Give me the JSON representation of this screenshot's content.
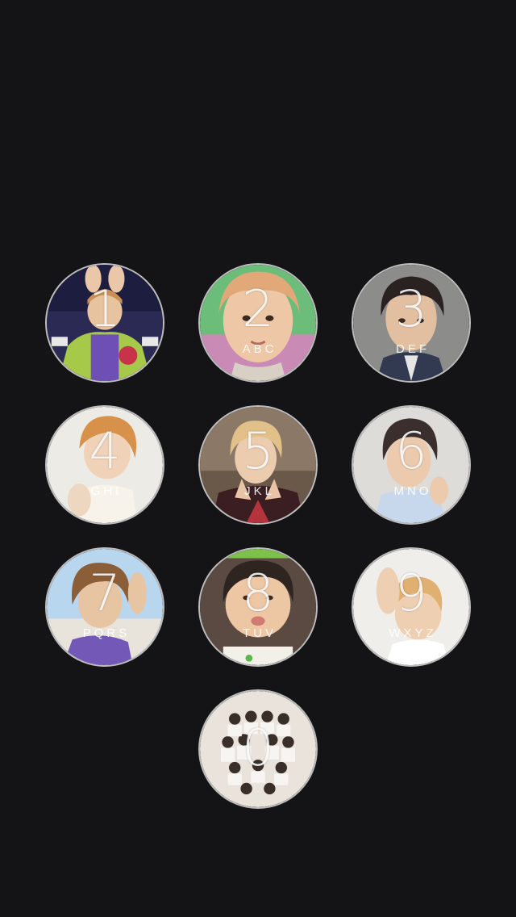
{
  "keypad": {
    "keys": [
      {
        "digit": "1",
        "letters": "",
        "photo_icon": "member-photo-bunny-ears-varsity-jacket"
      },
      {
        "digit": "2",
        "letters": "ABC",
        "photo_icon": "member-photo-blond-hair-closeup"
      },
      {
        "digit": "3",
        "letters": "DEF",
        "photo_icon": "member-photo-dark-hair-grey-background"
      },
      {
        "digit": "4",
        "letters": "GHI",
        "photo_icon": "member-photo-orange-hair-white-background"
      },
      {
        "digit": "5",
        "letters": "JKL",
        "photo_icon": "member-photo-blond-hair-peace-sign"
      },
      {
        "digit": "6",
        "letters": "MNO",
        "photo_icon": "member-photo-dark-hair-smiling"
      },
      {
        "digit": "7",
        "letters": "PQRS",
        "photo_icon": "member-photo-brown-hair-sky-background"
      },
      {
        "digit": "8",
        "letters": "TUV",
        "photo_icon": "member-photo-puffed-cheeks-green-text"
      },
      {
        "digit": "9",
        "letters": "WXYZ",
        "photo_icon": "member-photo-blond-hair-arm-raised"
      },
      {
        "digit": "0",
        "letters": "",
        "photo_icon": "group-photo-white-outfits"
      }
    ]
  },
  "colors": {
    "background": "#141416",
    "key_border": "#d9d9d9",
    "label": "#ffffff"
  }
}
